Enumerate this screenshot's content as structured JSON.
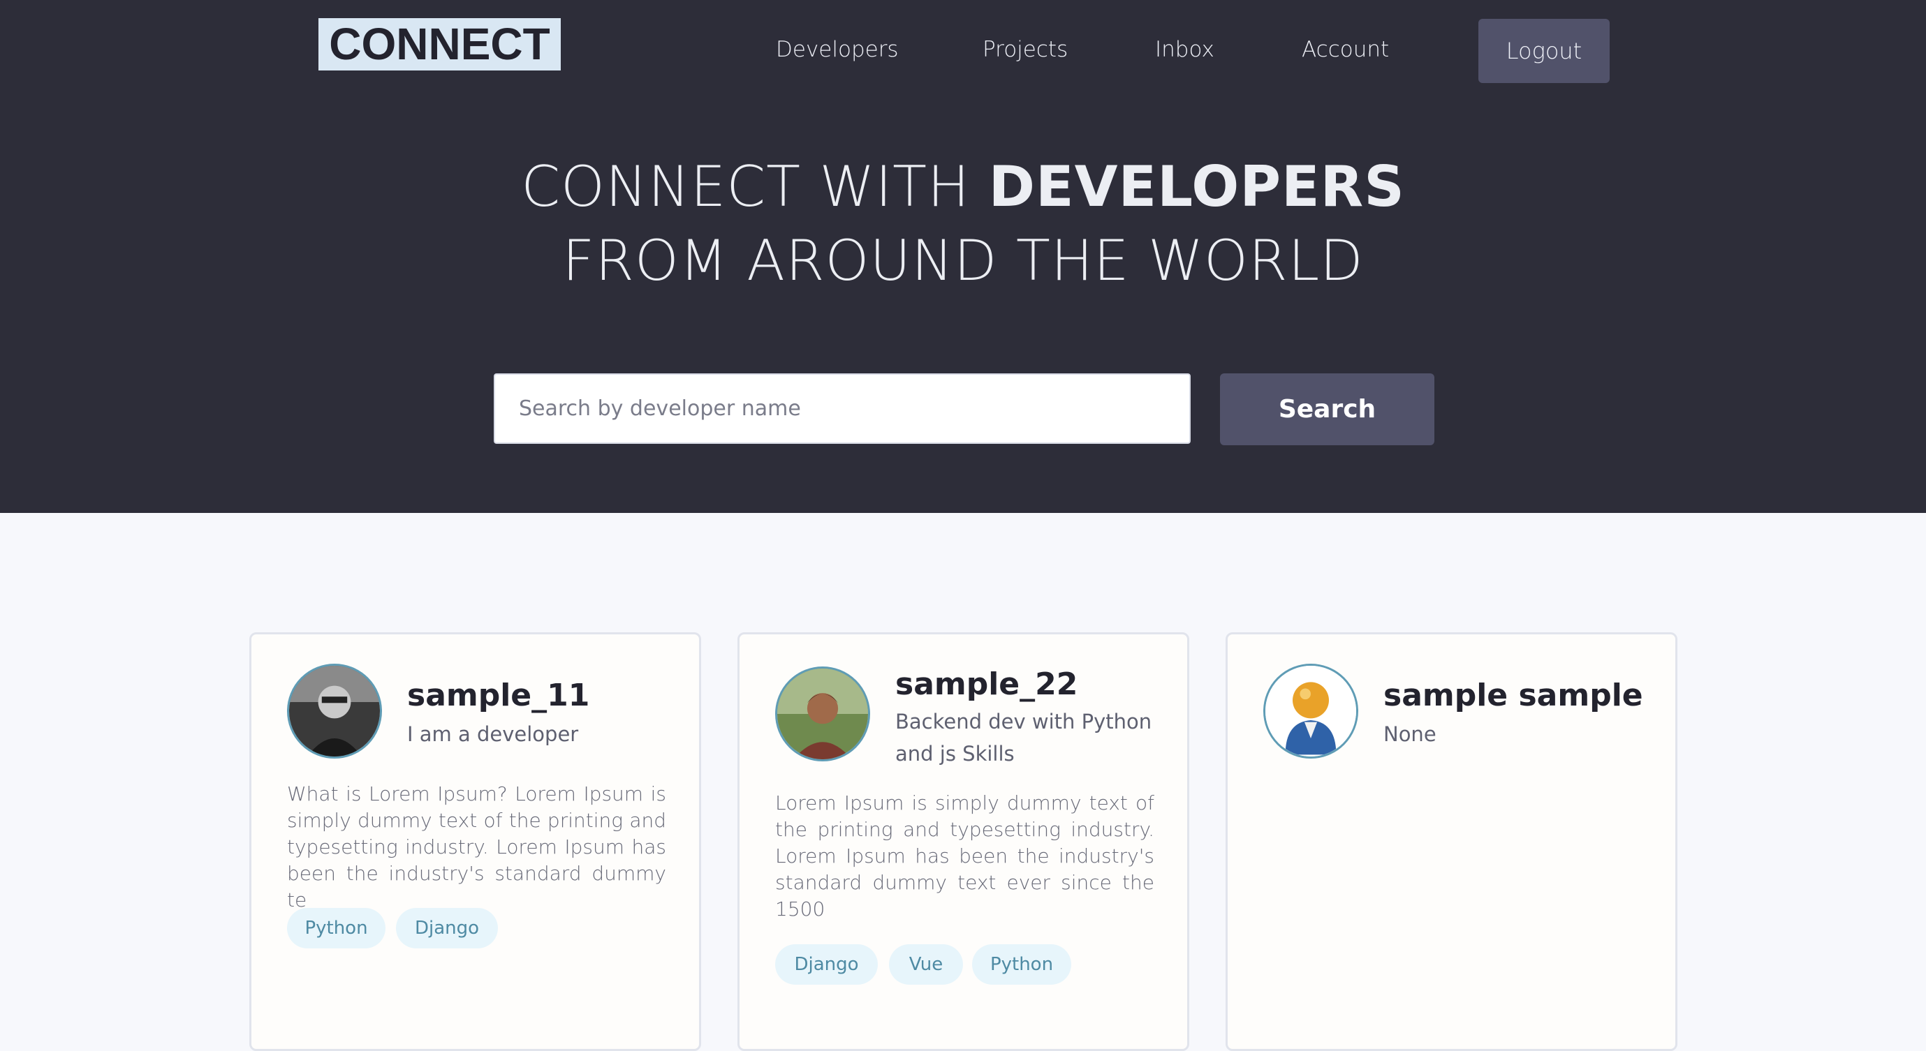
{
  "header": {
    "logo": "CONNECT",
    "nav": [
      "Developers",
      "Projects",
      "Inbox",
      "Account"
    ],
    "logout": "Logout"
  },
  "hero": {
    "line1_pre": "CONNECT WITH ",
    "line1_bold": "DEVELOPERS",
    "line2": "FROM AROUND THE WORLD"
  },
  "search": {
    "placeholder": "Search by developer name",
    "button": "Search"
  },
  "cards": [
    {
      "name": "sample_11",
      "role": "I am a developer",
      "bio": "What is Lorem Ipsum? Lorem Ipsum is simply dummy text of the printing and typesetting industry. Lorem Ipsum has been the industry's standard dummy te",
      "tags": [
        "Python",
        "Django"
      ]
    },
    {
      "name": "sample_22",
      "role": "Backend dev with Python and js Skills",
      "bio": "Lorem Ipsum is simply dummy text of the printing and typesetting industry. Lorem Ipsum has been the industry's standard dummy text ever since the 1500",
      "tags": [
        "Django",
        "Vue",
        "Python"
      ]
    },
    {
      "name": "sample sample",
      "role": "None",
      "bio": "",
      "tags": []
    }
  ]
}
